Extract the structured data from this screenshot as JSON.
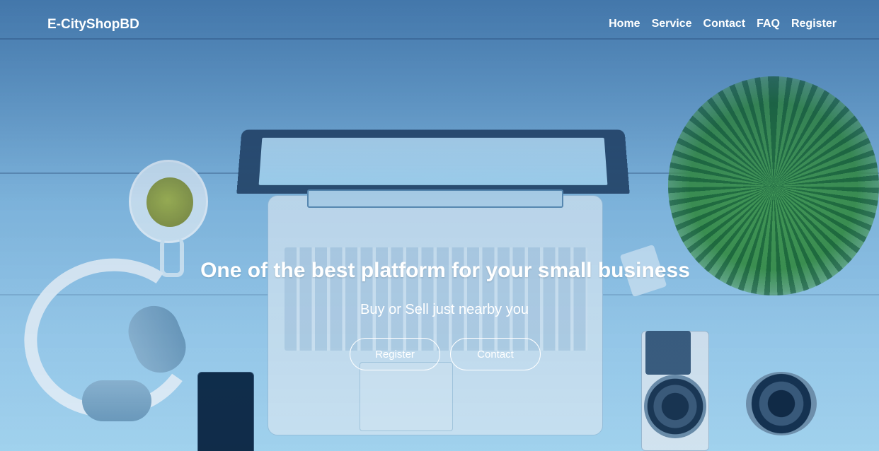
{
  "nav": {
    "brand": "E-CityShopBD",
    "links": [
      "Home",
      "Service",
      "Contact",
      "FAQ",
      "Register"
    ]
  },
  "hero": {
    "title": "One of the best platform for your small business",
    "subtitle": "Buy or Sell just nearby you",
    "buttons": {
      "register": "Register",
      "contact": "Contact"
    }
  },
  "colors": {
    "overlay_tint": "#5d97c6",
    "text": "#ffffff"
  }
}
